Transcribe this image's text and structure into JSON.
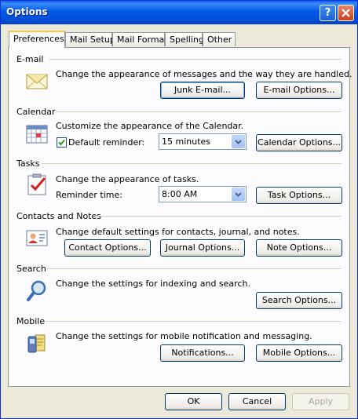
{
  "window": {
    "title": "Options",
    "help_icon": "question-mark-icon",
    "close_icon": "close-x-icon"
  },
  "tabs": [
    "Preferences",
    "Mail Setup",
    "Mail Format",
    "Spelling",
    "Other"
  ],
  "active_tab": "Preferences",
  "sections": {
    "email": {
      "title": "E-mail",
      "icon": "envelope-icon",
      "description": "Change the appearance of messages and the way they are handled.",
      "buttons": [
        "Junk E-mail...",
        "E-mail Options..."
      ]
    },
    "calendar": {
      "title": "Calendar",
      "icon": "calendar-icon",
      "description": "Customize the appearance of the Calendar.",
      "checkbox_label": "Default reminder:",
      "checkbox_checked": true,
      "reminder_value": "15 minutes",
      "buttons": [
        "Calendar Options..."
      ]
    },
    "tasks": {
      "title": "Tasks",
      "icon": "task-checklist-icon",
      "description": "Change the appearance of tasks.",
      "reminder_label": "Reminder time:",
      "reminder_value": "8:00 AM",
      "buttons": [
        "Task Options..."
      ]
    },
    "contacts": {
      "title": "Contacts and Notes",
      "icon": "contact-card-icon",
      "description": "Change default settings for contacts, journal, and notes.",
      "buttons": [
        "Contact Options...",
        "Journal Options...",
        "Note Options..."
      ]
    },
    "search": {
      "title": "Search",
      "icon": "magnifier-icon",
      "description": "Change the settings for indexing and search.",
      "buttons": [
        "Search Options..."
      ]
    },
    "mobile": {
      "title": "Mobile",
      "icon": "mobile-phone-icon",
      "description": "Change the settings for mobile notification and messaging.",
      "buttons": [
        "Notifications...",
        "Mobile Options..."
      ]
    }
  },
  "footer": {
    "ok": "OK",
    "cancel": "Cancel",
    "apply": "Apply",
    "apply_enabled": false
  }
}
